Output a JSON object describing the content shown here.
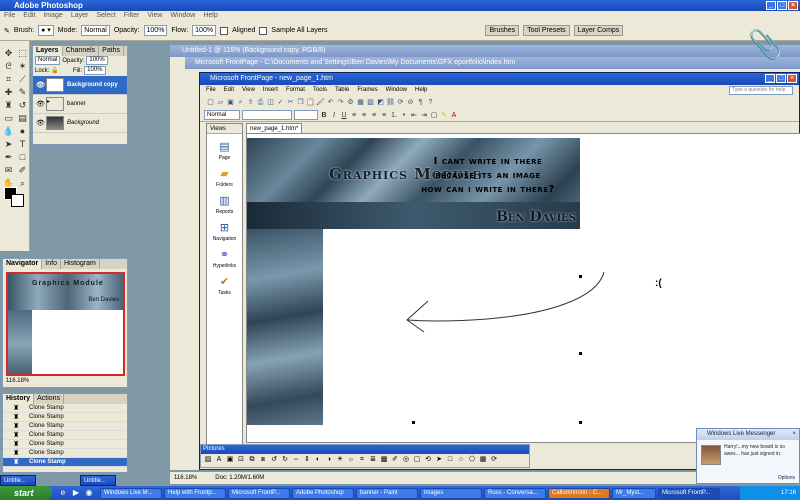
{
  "photoshop": {
    "title": "Adobe Photoshop",
    "menu": [
      "File",
      "Edit",
      "Image",
      "Layer",
      "Select",
      "Filter",
      "View",
      "Window",
      "Help"
    ],
    "options": {
      "brush_label": "Brush:",
      "mode_label": "Mode:",
      "mode_value": "Normal",
      "opacity_label": "Opacity:",
      "opacity_value": "100%",
      "flow_label": "Flow:",
      "flow_value": "100%",
      "aligned_label": "Aligned",
      "sample_label": "Sample All Layers",
      "tabs": [
        "Brushes",
        "Tool Presets",
        "Layer Comps"
      ]
    },
    "layers_palette": {
      "tabs": [
        "Layers",
        "Channels",
        "Paths"
      ],
      "mode": "Normal",
      "opacity_label": "Opacity:",
      "opacity_value": "100%",
      "lock_label": "Lock:",
      "fill_label": "Fill:",
      "fill_value": "100%",
      "items": [
        {
          "name": "Background copy",
          "active": true
        },
        {
          "name": "banner",
          "active": false
        },
        {
          "name": "Background",
          "active": false
        }
      ]
    },
    "navigator": {
      "tabs": [
        "Navigator",
        "Info",
        "Histogram"
      ],
      "title": "Graphics Module",
      "subtitle": "Ben Davies",
      "zoom": "116.18%"
    },
    "history": {
      "tabs": [
        "History",
        "Actions"
      ],
      "items": [
        "Clone Stamp",
        "Clone Stamp",
        "Clone Stamp",
        "Clone Stamp",
        "Clone Stamp",
        "Clone Stamp",
        "Clone Stamp"
      ]
    },
    "doc_title": "Untitled-1 @ 116% (Background copy, RGB/8)",
    "doc_title2": "Microsoft FrontPage - C:\\Documents and Settings\\Ben Davies\\My Documents\\GFX eportfolio\\index.htm",
    "status_zoom": "116.18%",
    "status_doc": "Doc: 1.20M/1.60M"
  },
  "frontpage": {
    "title": "Microsoft FrontPage - new_page_1.htm",
    "menu": [
      "File",
      "Edit",
      "View",
      "Insert",
      "Format",
      "Tools",
      "Table",
      "Frames",
      "Window",
      "Help"
    ],
    "ask_placeholder": "Type a question for help",
    "style_value": "Normal",
    "views_header": "Views",
    "views": [
      {
        "label": "Page",
        "icon": "page-icon"
      },
      {
        "label": "Folders",
        "icon": "folders-icon"
      },
      {
        "label": "Reports",
        "icon": "reports-icon"
      },
      {
        "label": "Navigation",
        "icon": "navigation-icon"
      },
      {
        "label": "Hyperlinks",
        "icon": "hyperlinks-icon"
      },
      {
        "label": "Tasks",
        "icon": "tasks-icon"
      }
    ],
    "tab": "new_page_1.htm*",
    "banner_title": "Graphics Module",
    "banner_name": "Ben Davies",
    "note_lines": [
      "I cant write in there",
      "because its an image",
      "how can i write in there?"
    ],
    "sad_face": ":(",
    "pictures_title": "Pictures"
  },
  "clippy": {
    "icon": "paperclip-icon"
  },
  "messenger": {
    "title": "Windows Live Messenger",
    "message": "Harry!...my new board is so awes... has just signed in.",
    "options": "Options"
  },
  "taskbar": {
    "start": "start",
    "minimized": [
      "Untitle...",
      "Untitle..."
    ],
    "tasks": [
      {
        "label": "Windows Live M...",
        "active": false
      },
      {
        "label": "Help with Frontp...",
        "active": false
      },
      {
        "label": "Microsoft FrontP...",
        "active": false
      },
      {
        "label": "Adobe Photoshop",
        "active": false
      },
      {
        "label": "banner - Paint",
        "active": false
      },
      {
        "label": "images",
        "active": false
      },
      {
        "label": "Ross - Conversa...",
        "active": false
      },
      {
        "label": "Callumnnnnn - C...",
        "active": false
      },
      {
        "label": "Mr_Myst...",
        "active": false
      },
      {
        "label": "Microsoft FrontP...",
        "active": true
      }
    ],
    "clock": "17:16"
  }
}
